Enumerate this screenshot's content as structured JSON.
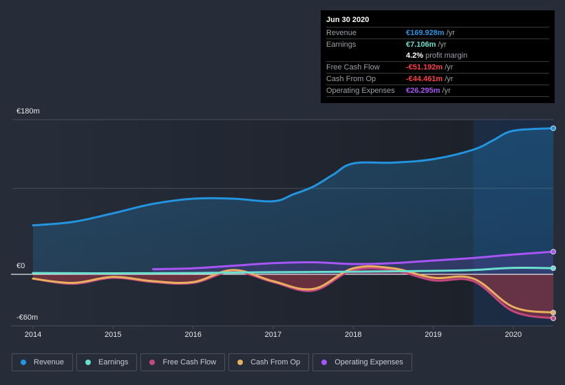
{
  "tooltip": {
    "date": "Jun 30 2020",
    "rows": [
      {
        "label": "Revenue",
        "value": "€169.928m",
        "unit": "/yr",
        "color": "#2394df"
      },
      {
        "label": "Earnings",
        "value": "€7.106m",
        "unit": "/yr",
        "color": "#6ce0cf"
      },
      {
        "label": "",
        "value": "4.2%",
        "unit": "profit margin",
        "color": "#ffffff"
      },
      {
        "label": "Free Cash Flow",
        "value": "-€51.192m",
        "unit": "/yr",
        "color": "#ff4040"
      },
      {
        "label": "Cash From Op",
        "value": "-€44.461m",
        "unit": "/yr",
        "color": "#ff4040"
      },
      {
        "label": "Operating Expenses",
        "value": "€26.295m",
        "unit": "/yr",
        "color": "#a855f7"
      }
    ]
  },
  "legend": [
    {
      "label": "Revenue",
      "color": "#2394df"
    },
    {
      "label": "Earnings",
      "color": "#6ce0cf"
    },
    {
      "label": "Free Cash Flow",
      "color": "#c5477f"
    },
    {
      "label": "Cash From Op",
      "color": "#e8b05e"
    },
    {
      "label": "Operating Expenses",
      "color": "#a855f7"
    }
  ],
  "chart_data": {
    "type": "area",
    "title": "",
    "xlabel": "",
    "ylabel": "",
    "x_ticks": [
      "2014",
      "2015",
      "2016",
      "2017",
      "2018",
      "2019",
      "2020"
    ],
    "y_ticks": [
      "€180m",
      "€0",
      "-€60m"
    ],
    "xlim": [
      2014.0,
      2020.5
    ],
    "ylim": [
      -60,
      180
    ],
    "highlight_from": 2019.5,
    "grid": true,
    "legend_position": "bottom",
    "series": [
      {
        "name": "Revenue",
        "color": "#2394df",
        "x": [
          2014.0,
          2014.5,
          2015.0,
          2015.5,
          2016.0,
          2016.5,
          2017.0,
          2017.25,
          2017.5,
          2017.75,
          2018.0,
          2018.5,
          2019.0,
          2019.5,
          2019.75,
          2020.0,
          2020.5
        ],
        "values": [
          57,
          61,
          71,
          82,
          88,
          88,
          85,
          93,
          102,
          116,
          129,
          130,
          134,
          145,
          156,
          167,
          170
        ]
      },
      {
        "name": "Earnings",
        "color": "#6ce0cf",
        "x": [
          2014.0,
          2015.0,
          2016.0,
          2017.0,
          2018.0,
          2019.0,
          2019.5,
          2020.0,
          2020.5
        ],
        "values": [
          1.5,
          1.2,
          1.5,
          2.5,
          3,
          4,
          5,
          7.5,
          7.1
        ]
      },
      {
        "name": "Free Cash Flow",
        "color": "#c5477f",
        "x": [
          2014.0,
          2014.5,
          2015.0,
          2015.5,
          2016.0,
          2016.5,
          2017.0,
          2017.5,
          2018.0,
          2018.5,
          2019.0,
          2019.5,
          2020.0,
          2020.5
        ],
        "values": [
          -5,
          -11,
          -4,
          -9,
          -10,
          3,
          -9,
          -19,
          5,
          5,
          -7,
          -8,
          -43,
          -51.2
        ]
      },
      {
        "name": "Cash From Op",
        "color": "#e8b05e",
        "x": [
          2014.0,
          2014.5,
          2015.0,
          2015.5,
          2016.0,
          2016.5,
          2017.0,
          2017.5,
          2018.0,
          2018.5,
          2019.0,
          2019.5,
          2020.0,
          2020.5
        ],
        "values": [
          -5,
          -10,
          -3,
          -8,
          -9,
          5,
          -8,
          -17,
          7,
          7,
          -4,
          -5,
          -38,
          -44.5
        ]
      },
      {
        "name": "Operating Expenses",
        "color": "#a855f7",
        "x": [
          2015.5,
          2016.0,
          2016.5,
          2017.0,
          2017.5,
          2018.0,
          2018.5,
          2019.0,
          2019.5,
          2020.0,
          2020.5
        ],
        "values": [
          6,
          7,
          10,
          13,
          14,
          12,
          13,
          16,
          19,
          23,
          26.3
        ]
      }
    ]
  }
}
